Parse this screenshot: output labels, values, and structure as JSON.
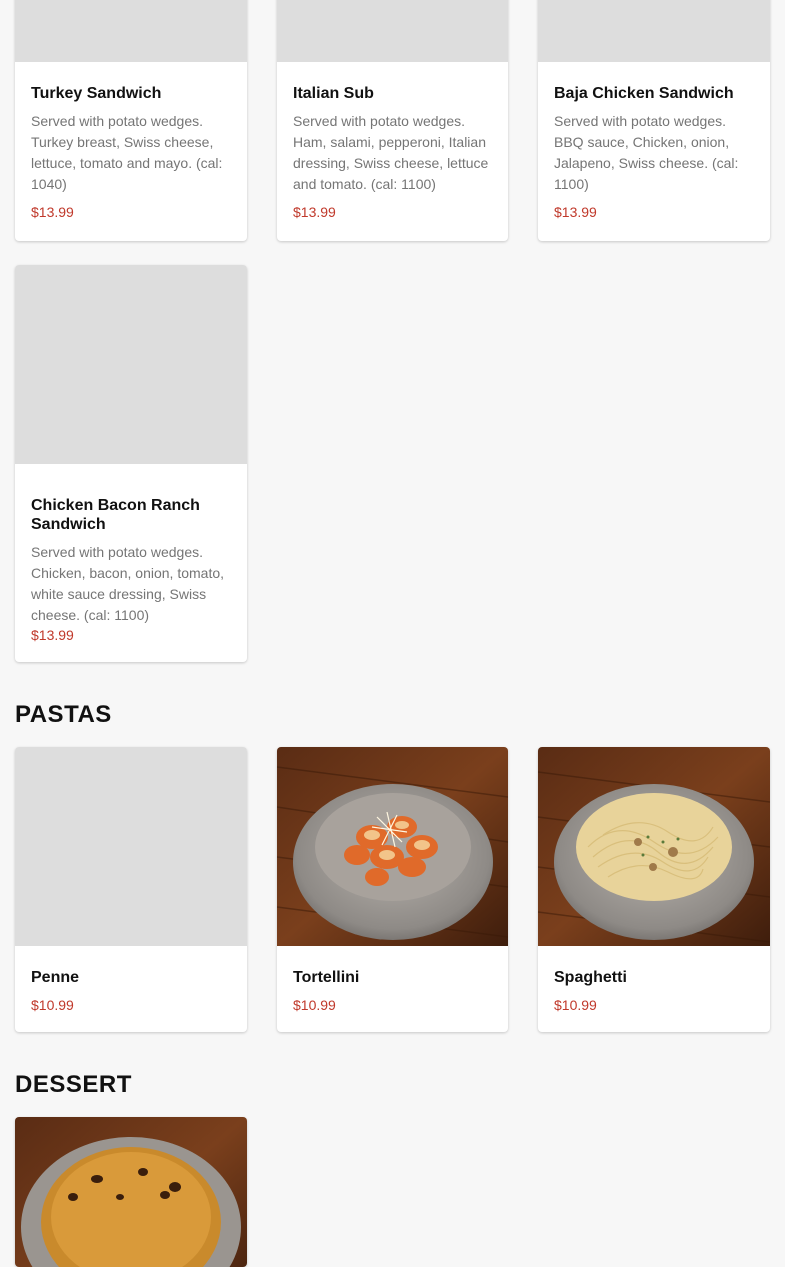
{
  "sections": [
    {
      "items": [
        {
          "title": "Turkey Sandwich",
          "description": "Served with potato wedges. Turkey breast, Swiss cheese, lettuce, tomato and mayo. (cal: 1040)",
          "price": "$13.99"
        },
        {
          "title": "Italian Sub",
          "description": "Served with potato wedges. Ham, salami, pepperoni, Italian dressing, Swiss cheese, lettuce and tomato. (cal: 1100)",
          "price": "$13.99"
        },
        {
          "title": "Baja Chicken Sandwich",
          "description": "Served with potato wedges. BBQ sauce, Chicken, onion, Jalapeno, Swiss cheese. (cal: 1100)",
          "price": "$13.99"
        },
        {
          "title": "Chicken Bacon Ranch Sandwich",
          "description": "Served with potato wedges. Chicken, bacon, onion, tomato, white sauce dressing, Swiss cheese. (cal: 1100)",
          "price": "$13.99"
        }
      ]
    },
    {
      "title": "PASTAS",
      "items": [
        {
          "title": "Penne",
          "price": "$10.99"
        },
        {
          "title": "Tortellini",
          "price": "$10.99"
        },
        {
          "title": "Spaghetti",
          "price": "$10.99"
        }
      ]
    },
    {
      "title": "DESSERT"
    }
  ],
  "colors": {
    "price": "#c0392b",
    "placeholder": "#dddddd"
  }
}
